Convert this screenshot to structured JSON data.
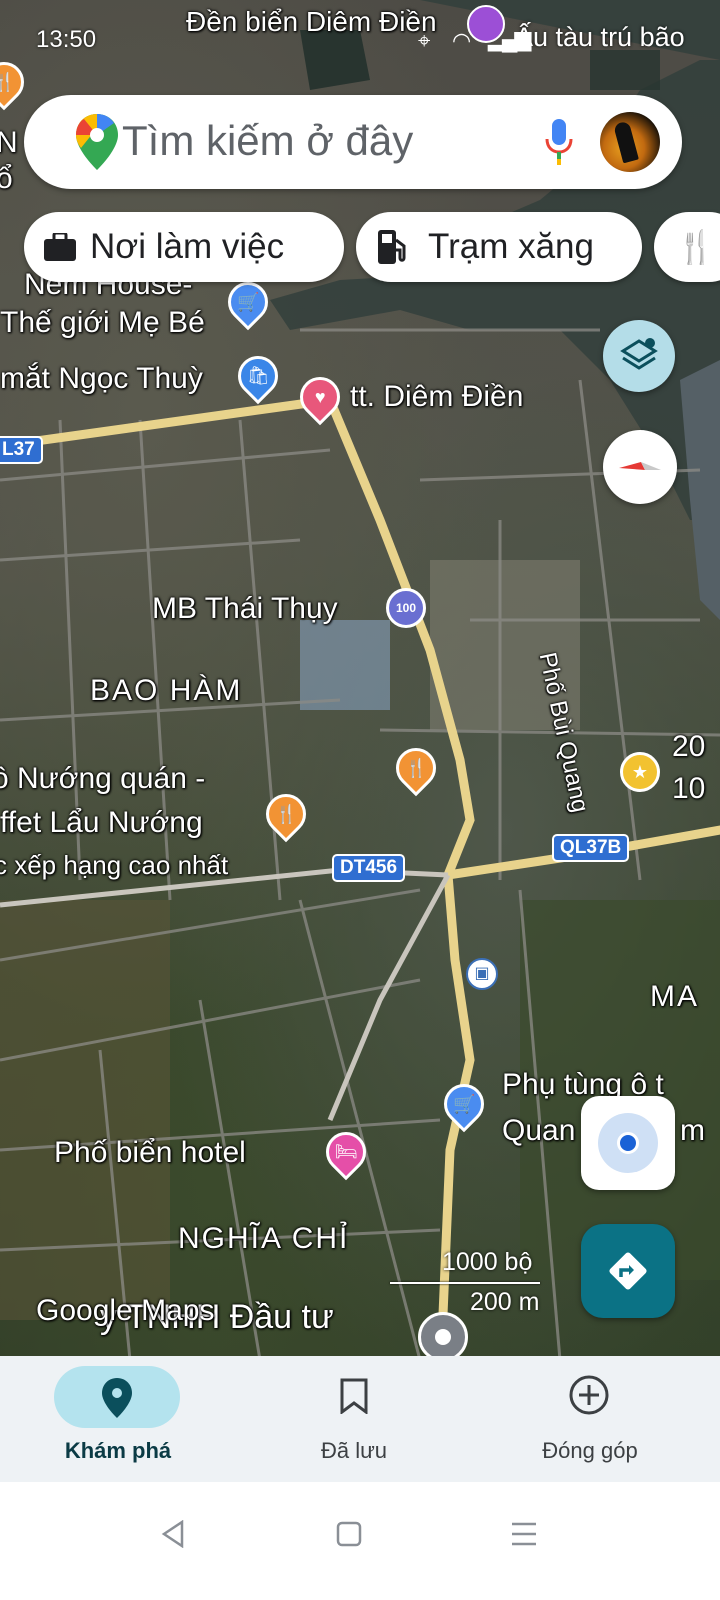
{
  "status_bar": {
    "time": "13:50",
    "notification_text": "Ấu tàu trú bão",
    "top_place_label": "Đền biển Diêm Điền"
  },
  "search": {
    "placeholder": "Tìm kiếm ở đây",
    "icons": [
      "google-maps-logo-icon",
      "microphone-icon",
      "avatar"
    ]
  },
  "chips": [
    {
      "label": "Nơi làm việc",
      "icon": "briefcase-icon"
    },
    {
      "label": "Trạm xăng",
      "icon": "gas-station-icon"
    },
    {
      "label": "",
      "icon": "restaurant-icon"
    }
  ],
  "map": {
    "labels": {
      "nem_house": "Nem House-",
      "the_gioi_me_be": "Thế giới Mẹ Bé",
      "mat_ngoc_thuy": "mắt Ngọc Thuỳ",
      "tt_diem_dien": "tt. Diêm Điền",
      "mb_thai_thuy": "MB Thái Thụy",
      "bao_ham": "BAO HÀM",
      "nuong_quan": "ồ Nướng quán -",
      "buffet_lau_nuong": "ffet Lẩu Nướng",
      "xep_hang": "c xếp hạng cao nhất",
      "pho_bui_quang": "Phố Bùi Quang",
      "rating_line1": "20",
      "rating_line2": "10",
      "ma": "MA",
      "phu_tung_1": "Phụ tùng ô t",
      "phu_tung_2": "Quan",
      "phu_tung_3": "m",
      "pho_bien_hotel": "Phố biển hotel",
      "nghia_chi": "NGHĨA CHỈ",
      "cty_dau_tu": "y TNHH Đầu tư",
      "left_o": "ổ",
      "left_n": "N"
    },
    "road_shields": {
      "ql37_left": "L37",
      "ql37b": "QL37B",
      "dt456": "DT456"
    },
    "scale": {
      "feet": "1000 bộ",
      "meters": "200 m"
    },
    "watermark": "Google Maps",
    "colors": {
      "road": "#e8d38c",
      "water": "#2f3a3f",
      "button_teal": "#0b7285"
    }
  },
  "bottom_nav": {
    "items": [
      {
        "label": "Khám phá",
        "icon": "location-pin-icon",
        "active": true
      },
      {
        "label": "Đã lưu",
        "icon": "bookmark-icon",
        "active": false
      },
      {
        "label": "Đóng góp",
        "icon": "add-circle-icon",
        "active": false
      }
    ]
  },
  "system_nav": {
    "icons": [
      "back-icon",
      "home-icon",
      "recents-icon"
    ]
  }
}
